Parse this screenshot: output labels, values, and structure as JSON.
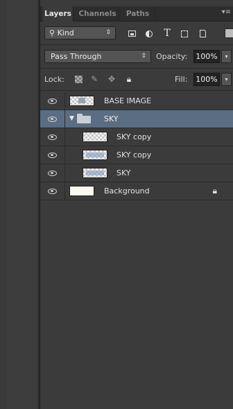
{
  "tabs": [
    {
      "label": "Layers",
      "active": true
    },
    {
      "label": "Channels",
      "active": false
    },
    {
      "label": "Paths",
      "active": false
    }
  ],
  "tab_menu_icon": "panel-menu-icon",
  "filter": {
    "kind_label": "Kind",
    "kind_icon": "search-icon",
    "filter_icons": [
      "pixel-layer-filter-icon",
      "adjustment-layer-filter-icon",
      "type-layer-filter-icon",
      "shape-layer-filter-icon",
      "smart-object-filter-icon",
      "filter-toggle-icon"
    ],
    "type_glyph": "T"
  },
  "blend": {
    "mode": "Pass Through",
    "opacity_label": "Opacity:",
    "opacity_value": "100%"
  },
  "lock": {
    "label": "Lock:",
    "icons": [
      "lock-transparent-pixels-icon",
      "lock-image-pixels-icon",
      "lock-position-icon",
      "lock-all-icon"
    ],
    "fill_label": "Fill:",
    "fill_value": "100%"
  },
  "layers": [
    {
      "name": "BASE IMAGE",
      "visible": true,
      "selected": false,
      "type": "layer",
      "indent": 0
    },
    {
      "name": "SKY",
      "visible": true,
      "selected": true,
      "type": "group",
      "expanded": true,
      "indent": 0
    },
    {
      "name": "SKY copy",
      "visible": true,
      "selected": false,
      "type": "layer",
      "indent": 1
    },
    {
      "name": "SKY copy",
      "visible": true,
      "selected": false,
      "type": "layer",
      "indent": 1
    },
    {
      "name": "SKY",
      "visible": true,
      "selected": false,
      "type": "layer",
      "indent": 1
    },
    {
      "name": "Background",
      "visible": true,
      "selected": false,
      "type": "background",
      "locked": true,
      "indent": 0
    }
  ],
  "colors": {
    "panel_bg": "#3b3b3b",
    "selected_row": "#5a6d82",
    "tab_bar": "#2d2d2d"
  }
}
